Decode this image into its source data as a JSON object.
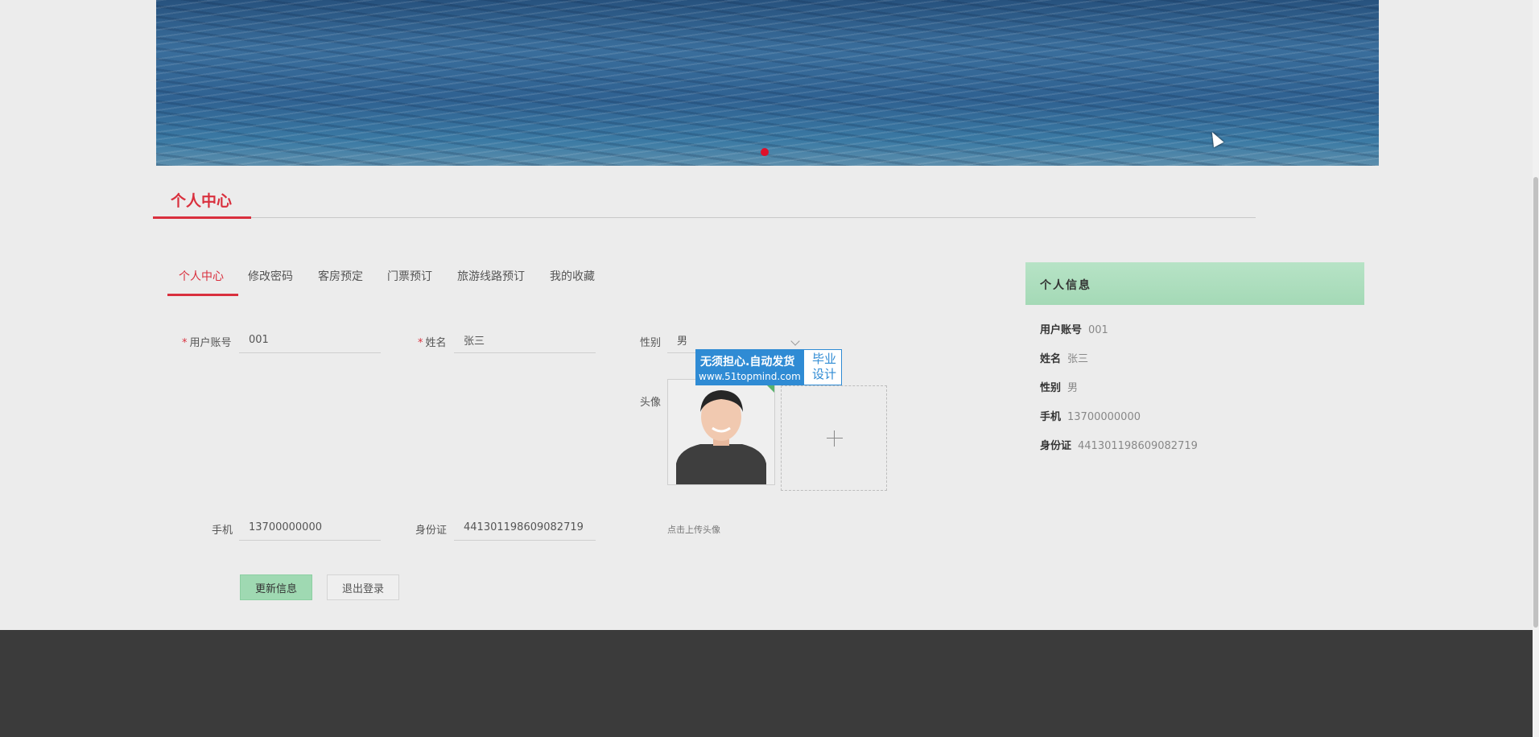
{
  "section": {
    "title": "个人中心"
  },
  "tabs": [
    {
      "label": "个人中心"
    },
    {
      "label": "修改密码"
    },
    {
      "label": "客房预定"
    },
    {
      "label": "门票预订"
    },
    {
      "label": "旅游线路预订"
    },
    {
      "label": "我的收藏"
    }
  ],
  "form": {
    "account_label": "用户账号",
    "account_value": "001",
    "name_label": "姓名",
    "name_value": "张三",
    "gender_label": "性别",
    "gender_value": "男",
    "avatar_label": "头像",
    "phone_label": "手机",
    "phone_value": "13700000000",
    "idcard_label": "身份证",
    "idcard_value": "441301198609082719",
    "upload_hint": "点击上传头像",
    "required_mark": "*"
  },
  "buttons": {
    "update": "更新信息",
    "logout": "退出登录"
  },
  "info_card": {
    "title": "个人信息",
    "rows": [
      {
        "key": "用户账号",
        "value": "001"
      },
      {
        "key": "姓名",
        "value": "张三"
      },
      {
        "key": "性别",
        "value": "男"
      },
      {
        "key": "手机",
        "value": "13700000000"
      },
      {
        "key": "身份证",
        "value": "441301198609082719"
      }
    ]
  },
  "watermark": {
    "line1": "无须担心.自动发货",
    "line2": "www.51topmind.com",
    "right": "毕业设计"
  },
  "colors": {
    "accent": "#d9303e",
    "header_green": "#b7e3c6",
    "button_green": "#9fd9b2",
    "footer": "#3b3b3b"
  }
}
